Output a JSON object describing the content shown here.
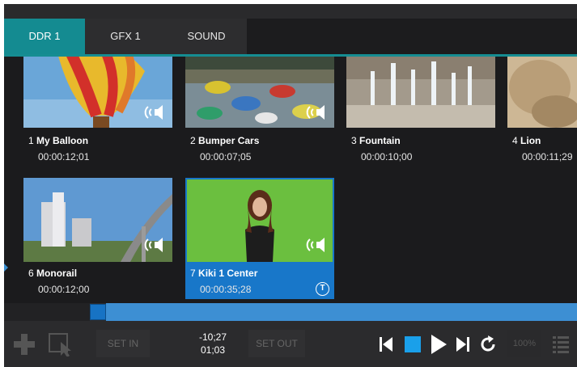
{
  "tabs": [
    {
      "label": "DDR 1",
      "active": true
    },
    {
      "label": "GFX 1",
      "active": false
    },
    {
      "label": "SOUND",
      "active": false
    }
  ],
  "clips": [
    {
      "number": "1",
      "name": "My Balloon",
      "timecode": "00:00:12;01",
      "selected": false,
      "audio": true
    },
    {
      "number": "2",
      "name": "Bumper Cars",
      "timecode": "00:00:07;05",
      "selected": false,
      "audio": true
    },
    {
      "number": "3",
      "name": "Fountain",
      "timecode": "00:00:10;00",
      "selected": false,
      "audio": false
    },
    {
      "number": "4",
      "name": "Lion",
      "timecode": "00:00:11;29",
      "selected": false,
      "audio": false
    },
    {
      "number": "6",
      "name": "Monorail",
      "timecode": "00:00:12;00",
      "selected": false,
      "audio": true
    },
    {
      "number": "7",
      "name": "Kiki 1 Center",
      "timecode": "00:00:35;28",
      "selected": true,
      "audio": true,
      "badge": "T"
    }
  ],
  "playback": {
    "progress_fraction": 0.15
  },
  "controls": {
    "set_in": "SET IN",
    "set_out": "SET OUT",
    "time_remaining": "-10;27",
    "time_elapsed": "01;03",
    "zoom": "100%"
  },
  "colors": {
    "accent_teal": "#158d92",
    "selection_blue": "#1877c9",
    "stop_blue": "#1aa0ea"
  }
}
